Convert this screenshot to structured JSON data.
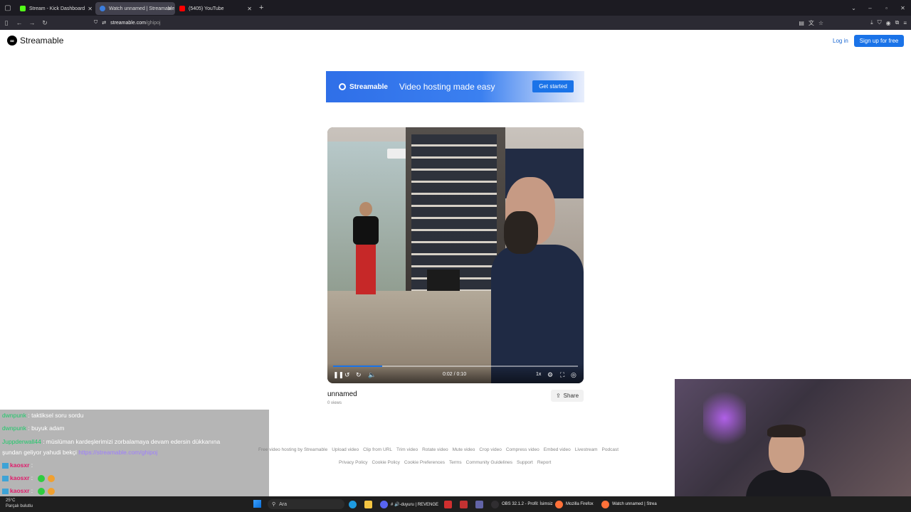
{
  "browser": {
    "tabs": [
      {
        "label": "Stream - Kick Dashboard",
        "icon": "kick-icon",
        "color": "#53fc18"
      },
      {
        "label": "Watch unnamed | Streamable",
        "icon": "streamable-icon",
        "color": "#3b7ddd",
        "active": true
      },
      {
        "label": "(5405) YouTube",
        "icon": "youtube-icon",
        "color": "#ff0000"
      }
    ],
    "url_host": "streamable.com",
    "url_path": "/ghipoj"
  },
  "header": {
    "logo_text": "Streamable",
    "login_label": "Log in",
    "signup_label": "Sign up for free"
  },
  "banner": {
    "brand": "Streamable",
    "tagline": "Video hosting made easy",
    "cta": "Get started"
  },
  "player": {
    "time": "0:02 / 0:10",
    "speed": "1x",
    "progress_fraction": 0.2,
    "title": "unnamed",
    "views": "0 views",
    "share_label": "Share"
  },
  "footer": {
    "row1": [
      "Free video hosting by Streamable",
      "Upload video",
      "Clip from URL",
      "Trim video",
      "Rotate video",
      "Mute video",
      "Crop video",
      "Compress video",
      "Embed video",
      "Livestream",
      "Podcast"
    ],
    "row2": [
      "Privacy Policy",
      "Cookie Policy",
      "Cookie Preferences",
      "Terms",
      "Community Guidelines",
      "Support",
      "Report"
    ]
  },
  "chat": [
    {
      "user": "dwnpunk",
      "text": ": taktiksel soru sordu"
    },
    {
      "user": "dwnpunk",
      "text": ": buyuk adam"
    },
    {
      "user": "Juppderwall44",
      "text": ": müslüman kardeşlerimizi zorbalamaya devam edersin dükkanına"
    },
    {
      "user": "",
      "text": "şundan geliyor yahudi bekçi",
      "link": "https://streamable.com/ghipoj"
    },
    {
      "user": "kaosxr",
      "text": ":"
    },
    {
      "user": "kaosxr",
      "text": ":"
    },
    {
      "user": "kaosxr",
      "text": ":"
    }
  ],
  "taskbar": {
    "weather_temp": "25°C",
    "weather_desc": "Parçalı bulutlu",
    "search_label": "Ara",
    "apps": [
      {
        "label": "# 🔊-duyuru | REVENGE",
        "icon": "discord-icon",
        "color": "#5865f2"
      },
      {
        "label": "OBS 32.1.2 - Profil: İsimsiz",
        "icon": "obs-icon",
        "color": "#302e31"
      },
      {
        "label": "Mozilla Firefox",
        "icon": "firefox-icon",
        "color": "#ff7139"
      },
      {
        "label": "Watch unnamed | Strea",
        "icon": "firefox-icon",
        "color": "#ff7139"
      }
    ]
  }
}
